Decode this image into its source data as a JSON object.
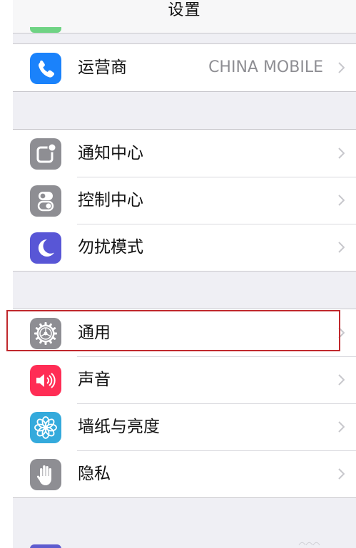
{
  "nav": {
    "title": "设置"
  },
  "groups": [
    {
      "rows": [
        {
          "icon": "phone-icon",
          "icon_color": "#1a82fb",
          "label": "运营商",
          "detail": "CHINA MOBILE"
        }
      ]
    },
    {
      "rows": [
        {
          "icon": "notification-center-icon",
          "icon_color": "#8e8e93",
          "label": "通知中心"
        },
        {
          "icon": "control-center-icon",
          "icon_color": "#8e8e93",
          "label": "控制中心"
        },
        {
          "icon": "moon-icon",
          "icon_color": "#5856d6",
          "label": "勿扰模式"
        }
      ]
    },
    {
      "rows": [
        {
          "icon": "gear-icon",
          "icon_color": "#8e8e93",
          "label": "通用",
          "highlighted": true
        },
        {
          "icon": "speaker-icon",
          "icon_color": "#ff2d55",
          "label": "声音"
        },
        {
          "icon": "flower-icon",
          "icon_color": "#34aadc",
          "label": "墙纸与亮度"
        },
        {
          "icon": "hand-icon",
          "icon_color": "#8e8e93",
          "label": "隐私"
        }
      ]
    }
  ],
  "highlight_color": "#c0282d"
}
